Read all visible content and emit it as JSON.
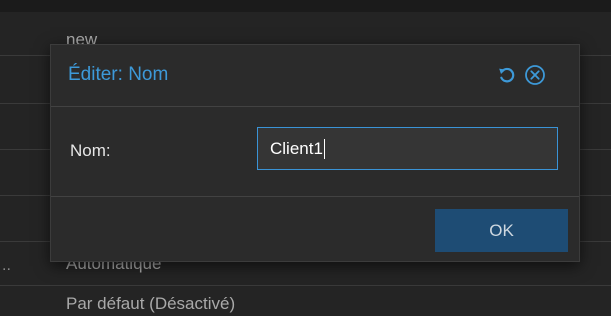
{
  "background": {
    "rows": [
      {
        "text": "new"
      },
      {
        "text": ""
      },
      {
        "text": ""
      },
      {
        "text": ""
      },
      {
        "text": ""
      },
      {
        "text": "Automatique"
      },
      {
        "text": "Par défaut (Désactivé)"
      }
    ],
    "row_marker": ".."
  },
  "dialog": {
    "title": "Éditer: Nom",
    "reset_icon": "reset-icon",
    "close_icon": "close-circle-icon",
    "field": {
      "label": "Nom:",
      "value": "Client1"
    },
    "ok_label": "OK"
  },
  "colors": {
    "accent": "#3d99d8",
    "button": "#1e4c74",
    "dialog_bg": "#2b2b2b",
    "page_bg": "#242424"
  }
}
